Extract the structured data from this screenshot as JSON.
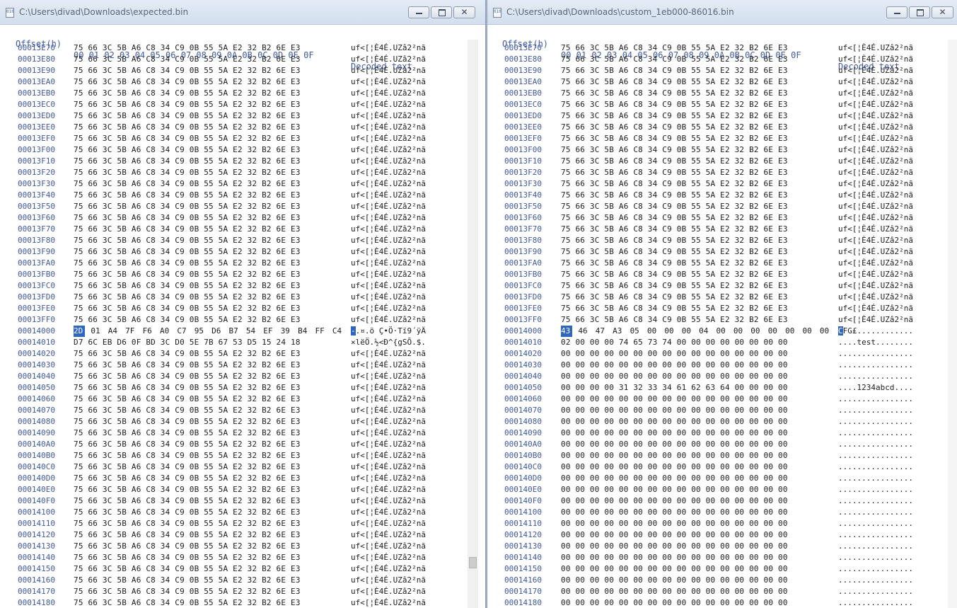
{
  "left": {
    "title": "C:\\Users\\divad\\Downloads\\expected.bin",
    "header": {
      "offset": "Offset(h)",
      "bytes": "00 01 02 03 04 05 06 07 08 09 0A 0B 0C 0D 0E 0F",
      "decoded": "Decoded text"
    },
    "rows": [
      {
        "offset": "00013E70",
        "hex": "75 66 3C 5B A6 C8 34 C9 0B 55 5A E2 32 B2 6E E3",
        "dec": "uf<[¦È4É.UZâ2²nã"
      },
      {
        "offset": "00013E80",
        "hex": "75 66 3C 5B A6 C8 34 C9 0B 55 5A E2 32 B2 6E E3",
        "dec": "uf<[¦È4É.UZâ2²nã"
      },
      {
        "offset": "00013E90",
        "hex": "75 66 3C 5B A6 C8 34 C9 0B 55 5A E2 32 B2 6E E3",
        "dec": "uf<[¦È4É.UZâ2²nã"
      },
      {
        "offset": "00013EA0",
        "hex": "75 66 3C 5B A6 C8 34 C9 0B 55 5A E2 32 B2 6E E3",
        "dec": "uf<[¦È4É.UZâ2²nã"
      },
      {
        "offset": "00013EB0",
        "hex": "75 66 3C 5B A6 C8 34 C9 0B 55 5A E2 32 B2 6E E3",
        "dec": "uf<[¦È4É.UZâ2²nã"
      },
      {
        "offset": "00013EC0",
        "hex": "75 66 3C 5B A6 C8 34 C9 0B 55 5A E2 32 B2 6E E3",
        "dec": "uf<[¦È4É.UZâ2²nã"
      },
      {
        "offset": "00013ED0",
        "hex": "75 66 3C 5B A6 C8 34 C9 0B 55 5A E2 32 B2 6E E3",
        "dec": "uf<[¦È4É.UZâ2²nã"
      },
      {
        "offset": "00013EE0",
        "hex": "75 66 3C 5B A6 C8 34 C9 0B 55 5A E2 32 B2 6E E3",
        "dec": "uf<[¦È4É.UZâ2²nã"
      },
      {
        "offset": "00013EF0",
        "hex": "75 66 3C 5B A6 C8 34 C9 0B 55 5A E2 32 B2 6E E3",
        "dec": "uf<[¦È4É.UZâ2²nã"
      },
      {
        "offset": "00013F00",
        "hex": "75 66 3C 5B A6 C8 34 C9 0B 55 5A E2 32 B2 6E E3",
        "dec": "uf<[¦È4É.UZâ2²nã"
      },
      {
        "offset": "00013F10",
        "hex": "75 66 3C 5B A6 C8 34 C9 0B 55 5A E2 32 B2 6E E3",
        "dec": "uf<[¦È4É.UZâ2²nã"
      },
      {
        "offset": "00013F20",
        "hex": "75 66 3C 5B A6 C8 34 C9 0B 55 5A E2 32 B2 6E E3",
        "dec": "uf<[¦È4É.UZâ2²nã"
      },
      {
        "offset": "00013F30",
        "hex": "75 66 3C 5B A6 C8 34 C9 0B 55 5A E2 32 B2 6E E3",
        "dec": "uf<[¦È4É.UZâ2²nã"
      },
      {
        "offset": "00013F40",
        "hex": "75 66 3C 5B A6 C8 34 C9 0B 55 5A E2 32 B2 6E E3",
        "dec": "uf<[¦È4É.UZâ2²nã"
      },
      {
        "offset": "00013F50",
        "hex": "75 66 3C 5B A6 C8 34 C9 0B 55 5A E2 32 B2 6E E3",
        "dec": "uf<[¦È4É.UZâ2²nã"
      },
      {
        "offset": "00013F60",
        "hex": "75 66 3C 5B A6 C8 34 C9 0B 55 5A E2 32 B2 6E E3",
        "dec": "uf<[¦È4É.UZâ2²nã"
      },
      {
        "offset": "00013F70",
        "hex": "75 66 3C 5B A6 C8 34 C9 0B 55 5A E2 32 B2 6E E3",
        "dec": "uf<[¦È4É.UZâ2²nã"
      },
      {
        "offset": "00013F80",
        "hex": "75 66 3C 5B A6 C8 34 C9 0B 55 5A E2 32 B2 6E E3",
        "dec": "uf<[¦È4É.UZâ2²nã"
      },
      {
        "offset": "00013F90",
        "hex": "75 66 3C 5B A6 C8 34 C9 0B 55 5A E2 32 B2 6E E3",
        "dec": "uf<[¦È4É.UZâ2²nã"
      },
      {
        "offset": "00013FA0",
        "hex": "75 66 3C 5B A6 C8 34 C9 0B 55 5A E2 32 B2 6E E3",
        "dec": "uf<[¦È4É.UZâ2²nã"
      },
      {
        "offset": "00013FB0",
        "hex": "75 66 3C 5B A6 C8 34 C9 0B 55 5A E2 32 B2 6E E3",
        "dec": "uf<[¦È4É.UZâ2²nã"
      },
      {
        "offset": "00013FC0",
        "hex": "75 66 3C 5B A6 C8 34 C9 0B 55 5A E2 32 B2 6E E3",
        "dec": "uf<[¦È4É.UZâ2²nã"
      },
      {
        "offset": "00013FD0",
        "hex": "75 66 3C 5B A6 C8 34 C9 0B 55 5A E2 32 B2 6E E3",
        "dec": "uf<[¦È4É.UZâ2²nã"
      },
      {
        "offset": "00013FE0",
        "hex": "75 66 3C 5B A6 C8 34 C9 0B 55 5A E2 32 B2 6E E3",
        "dec": "uf<[¦È4É.UZâ2²nã"
      },
      {
        "offset": "00013FF0",
        "hex": "75 66 3C 5B A6 C8 34 C9 0B 55 5A E2 32 B2 6E E3",
        "dec": "uf<[¦È4É.UZâ2²nã"
      },
      {
        "offset": "00014000",
        "hex": "2D 01 A4 7F F6 A0 C7 95 D6 B7 54 EF 39 B4 FF C4",
        "dec": "-.¤.ö Ç•Ö·Tï9´ÿÄ",
        "selected": true
      },
      {
        "offset": "00014010",
        "hex": "D7 6C EB D6 0F BD 3C D0 5E 7B 67 53 D5 15 24 18",
        "dec": "×lëÖ.½<Ð^{gSÕ.$."
      },
      {
        "offset": "00014020",
        "hex": "75 66 3C 5B A6 C8 34 C9 0B 55 5A E2 32 B2 6E E3",
        "dec": "uf<[¦È4É.UZâ2²nã"
      },
      {
        "offset": "00014030",
        "hex": "75 66 3C 5B A6 C8 34 C9 0B 55 5A E2 32 B2 6E E3",
        "dec": "uf<[¦È4É.UZâ2²nã"
      },
      {
        "offset": "00014040",
        "hex": "75 66 3C 5B A6 C8 34 C9 0B 55 5A E2 32 B2 6E E3",
        "dec": "uf<[¦È4É.UZâ2²nã"
      },
      {
        "offset": "00014050",
        "hex": "75 66 3C 5B A6 C8 34 C9 0B 55 5A E2 32 B2 6E E3",
        "dec": "uf<[¦È4É.UZâ2²nã"
      },
      {
        "offset": "00014060",
        "hex": "75 66 3C 5B A6 C8 34 C9 0B 55 5A E2 32 B2 6E E3",
        "dec": "uf<[¦È4É.UZâ2²nã"
      },
      {
        "offset": "00014070",
        "hex": "75 66 3C 5B A6 C8 34 C9 0B 55 5A E2 32 B2 6E E3",
        "dec": "uf<[¦È4É.UZâ2²nã"
      },
      {
        "offset": "00014080",
        "hex": "75 66 3C 5B A6 C8 34 C9 0B 55 5A E2 32 B2 6E E3",
        "dec": "uf<[¦È4É.UZâ2²nã"
      },
      {
        "offset": "00014090",
        "hex": "75 66 3C 5B A6 C8 34 C9 0B 55 5A E2 32 B2 6E E3",
        "dec": "uf<[¦È4É.UZâ2²nã"
      },
      {
        "offset": "000140A0",
        "hex": "75 66 3C 5B A6 C8 34 C9 0B 55 5A E2 32 B2 6E E3",
        "dec": "uf<[¦È4É.UZâ2²nã"
      },
      {
        "offset": "000140B0",
        "hex": "75 66 3C 5B A6 C8 34 C9 0B 55 5A E2 32 B2 6E E3",
        "dec": "uf<[¦È4É.UZâ2²nã"
      },
      {
        "offset": "000140C0",
        "hex": "75 66 3C 5B A6 C8 34 C9 0B 55 5A E2 32 B2 6E E3",
        "dec": "uf<[¦È4É.UZâ2²nã"
      },
      {
        "offset": "000140D0",
        "hex": "75 66 3C 5B A6 C8 34 C9 0B 55 5A E2 32 B2 6E E3",
        "dec": "uf<[¦È4É.UZâ2²nã"
      },
      {
        "offset": "000140E0",
        "hex": "75 66 3C 5B A6 C8 34 C9 0B 55 5A E2 32 B2 6E E3",
        "dec": "uf<[¦È4É.UZâ2²nã"
      },
      {
        "offset": "000140F0",
        "hex": "75 66 3C 5B A6 C8 34 C9 0B 55 5A E2 32 B2 6E E3",
        "dec": "uf<[¦È4É.UZâ2²nã"
      },
      {
        "offset": "00014100",
        "hex": "75 66 3C 5B A6 C8 34 C9 0B 55 5A E2 32 B2 6E E3",
        "dec": "uf<[¦È4É.UZâ2²nã"
      },
      {
        "offset": "00014110",
        "hex": "75 66 3C 5B A6 C8 34 C9 0B 55 5A E2 32 B2 6E E3",
        "dec": "uf<[¦È4É.UZâ2²nã"
      },
      {
        "offset": "00014120",
        "hex": "75 66 3C 5B A6 C8 34 C9 0B 55 5A E2 32 B2 6E E3",
        "dec": "uf<[¦È4É.UZâ2²nã"
      },
      {
        "offset": "00014130",
        "hex": "75 66 3C 5B A6 C8 34 C9 0B 55 5A E2 32 B2 6E E3",
        "dec": "uf<[¦È4É.UZâ2²nã"
      },
      {
        "offset": "00014140",
        "hex": "75 66 3C 5B A6 C8 34 C9 0B 55 5A E2 32 B2 6E E3",
        "dec": "uf<[¦È4É.UZâ2²nã"
      },
      {
        "offset": "00014150",
        "hex": "75 66 3C 5B A6 C8 34 C9 0B 55 5A E2 32 B2 6E E3",
        "dec": "uf<[¦È4É.UZâ2²nã"
      },
      {
        "offset": "00014160",
        "hex": "75 66 3C 5B A6 C8 34 C9 0B 55 5A E2 32 B2 6E E3",
        "dec": "uf<[¦È4É.UZâ2²nã"
      },
      {
        "offset": "00014170",
        "hex": "75 66 3C 5B A6 C8 34 C9 0B 55 5A E2 32 B2 6E E3",
        "dec": "uf<[¦È4É.UZâ2²nã"
      },
      {
        "offset": "00014180",
        "hex": "75 66 3C 5B A6 C8 34 C9 0B 55 5A E2 32 B2 6E E3",
        "dec": "uf<[¦È4É.UZâ2²nã"
      }
    ]
  },
  "right": {
    "title": "C:\\Users\\divad\\Downloads\\custom_1eb000-86016.bin",
    "header": {
      "offset": "Offset(h)",
      "bytes": "00 01 02 03 04 05 06 07 08 09 0A 0B 0C 0D 0E 0F",
      "decoded": "Decoded text"
    },
    "rows": [
      {
        "offset": "00013E70",
        "hex": "75 66 3C 5B A6 C8 34 C9 0B 55 5A E2 32 B2 6E E3",
        "dec": "uf<[¦È4É.UZâ2²nã"
      },
      {
        "offset": "00013E80",
        "hex": "75 66 3C 5B A6 C8 34 C9 0B 55 5A E2 32 B2 6E E3",
        "dec": "uf<[¦È4É.UZâ2²nã"
      },
      {
        "offset": "00013E90",
        "hex": "75 66 3C 5B A6 C8 34 C9 0B 55 5A E2 32 B2 6E E3",
        "dec": "uf<[¦È4É.UZâ2²nã"
      },
      {
        "offset": "00013EA0",
        "hex": "75 66 3C 5B A6 C8 34 C9 0B 55 5A E2 32 B2 6E E3",
        "dec": "uf<[¦È4É.UZâ2²nã"
      },
      {
        "offset": "00013EB0",
        "hex": "75 66 3C 5B A6 C8 34 C9 0B 55 5A E2 32 B2 6E E3",
        "dec": "uf<[¦È4É.UZâ2²nã"
      },
      {
        "offset": "00013EC0",
        "hex": "75 66 3C 5B A6 C8 34 C9 0B 55 5A E2 32 B2 6E E3",
        "dec": "uf<[¦È4É.UZâ2²nã"
      },
      {
        "offset": "00013ED0",
        "hex": "75 66 3C 5B A6 C8 34 C9 0B 55 5A E2 32 B2 6E E3",
        "dec": "uf<[¦È4É.UZâ2²nã"
      },
      {
        "offset": "00013EE0",
        "hex": "75 66 3C 5B A6 C8 34 C9 0B 55 5A E2 32 B2 6E E3",
        "dec": "uf<[¦È4É.UZâ2²nã"
      },
      {
        "offset": "00013EF0",
        "hex": "75 66 3C 5B A6 C8 34 C9 0B 55 5A E2 32 B2 6E E3",
        "dec": "uf<[¦È4É.UZâ2²nã"
      },
      {
        "offset": "00013F00",
        "hex": "75 66 3C 5B A6 C8 34 C9 0B 55 5A E2 32 B2 6E E3",
        "dec": "uf<[¦È4É.UZâ2²nã"
      },
      {
        "offset": "00013F10",
        "hex": "75 66 3C 5B A6 C8 34 C9 0B 55 5A E2 32 B2 6E E3",
        "dec": "uf<[¦È4É.UZâ2²nã"
      },
      {
        "offset": "00013F20",
        "hex": "75 66 3C 5B A6 C8 34 C9 0B 55 5A E2 32 B2 6E E3",
        "dec": "uf<[¦È4É.UZâ2²nã"
      },
      {
        "offset": "00013F30",
        "hex": "75 66 3C 5B A6 C8 34 C9 0B 55 5A E2 32 B2 6E E3",
        "dec": "uf<[¦È4É.UZâ2²nã"
      },
      {
        "offset": "00013F40",
        "hex": "75 66 3C 5B A6 C8 34 C9 0B 55 5A E2 32 B2 6E E3",
        "dec": "uf<[¦È4É.UZâ2²nã"
      },
      {
        "offset": "00013F50",
        "hex": "75 66 3C 5B A6 C8 34 C9 0B 55 5A E2 32 B2 6E E3",
        "dec": "uf<[¦È4É.UZâ2²nã"
      },
      {
        "offset": "00013F60",
        "hex": "75 66 3C 5B A6 C8 34 C9 0B 55 5A E2 32 B2 6E E3",
        "dec": "uf<[¦È4É.UZâ2²nã"
      },
      {
        "offset": "00013F70",
        "hex": "75 66 3C 5B A6 C8 34 C9 0B 55 5A E2 32 B2 6E E3",
        "dec": "uf<[¦È4É.UZâ2²nã"
      },
      {
        "offset": "00013F80",
        "hex": "75 66 3C 5B A6 C8 34 C9 0B 55 5A E2 32 B2 6E E3",
        "dec": "uf<[¦È4É.UZâ2²nã"
      },
      {
        "offset": "00013F90",
        "hex": "75 66 3C 5B A6 C8 34 C9 0B 55 5A E2 32 B2 6E E3",
        "dec": "uf<[¦È4É.UZâ2²nã"
      },
      {
        "offset": "00013FA0",
        "hex": "75 66 3C 5B A6 C8 34 C9 0B 55 5A E2 32 B2 6E E3",
        "dec": "uf<[¦È4É.UZâ2²nã"
      },
      {
        "offset": "00013FB0",
        "hex": "75 66 3C 5B A6 C8 34 C9 0B 55 5A E2 32 B2 6E E3",
        "dec": "uf<[¦È4É.UZâ2²nã"
      },
      {
        "offset": "00013FC0",
        "hex": "75 66 3C 5B A6 C8 34 C9 0B 55 5A E2 32 B2 6E E3",
        "dec": "uf<[¦È4É.UZâ2²nã"
      },
      {
        "offset": "00013FD0",
        "hex": "75 66 3C 5B A6 C8 34 C9 0B 55 5A E2 32 B2 6E E3",
        "dec": "uf<[¦È4É.UZâ2²nã"
      },
      {
        "offset": "00013FE0",
        "hex": "75 66 3C 5B A6 C8 34 C9 0B 55 5A E2 32 B2 6E E3",
        "dec": "uf<[¦È4É.UZâ2²nã"
      },
      {
        "offset": "00013FF0",
        "hex": "75 66 3C 5B A6 C8 34 C9 0B 55 5A E2 32 B2 6E E3",
        "dec": "uf<[¦È4É.UZâ2²nã"
      },
      {
        "offset": "00014000",
        "hex": "43 46 47 A3 05 00 00 00 04 00 00 00 00 00 00 00",
        "dec": "CFG£............",
        "selected": true
      },
      {
        "offset": "00014010",
        "hex": "02 00 00 00 74 65 73 74 00 00 00 00 00 00 00 00",
        "dec": "....test........"
      },
      {
        "offset": "00014020",
        "hex": "00 00 00 00 00 00 00 00 00 00 00 00 00 00 00 00",
        "dec": "................"
      },
      {
        "offset": "00014030",
        "hex": "00 00 00 00 00 00 00 00 00 00 00 00 00 00 00 00",
        "dec": "................"
      },
      {
        "offset": "00014040",
        "hex": "00 00 00 00 00 00 00 00 00 00 00 00 00 00 00 00",
        "dec": "................"
      },
      {
        "offset": "00014050",
        "hex": "00 00 00 00 31 32 33 34 61 62 63 64 00 00 00 00",
        "dec": "....1234abcd...."
      },
      {
        "offset": "00014060",
        "hex": "00 00 00 00 00 00 00 00 00 00 00 00 00 00 00 00",
        "dec": "................"
      },
      {
        "offset": "00014070",
        "hex": "00 00 00 00 00 00 00 00 00 00 00 00 00 00 00 00",
        "dec": "................"
      },
      {
        "offset": "00014080",
        "hex": "00 00 00 00 00 00 00 00 00 00 00 00 00 00 00 00",
        "dec": "................"
      },
      {
        "offset": "00014090",
        "hex": "00 00 00 00 00 00 00 00 00 00 00 00 00 00 00 00",
        "dec": "................"
      },
      {
        "offset": "000140A0",
        "hex": "00 00 00 00 00 00 00 00 00 00 00 00 00 00 00 00",
        "dec": "................"
      },
      {
        "offset": "000140B0",
        "hex": "00 00 00 00 00 00 00 00 00 00 00 00 00 00 00 00",
        "dec": "................"
      },
      {
        "offset": "000140C0",
        "hex": "00 00 00 00 00 00 00 00 00 00 00 00 00 00 00 00",
        "dec": "................"
      },
      {
        "offset": "000140D0",
        "hex": "00 00 00 00 00 00 00 00 00 00 00 00 00 00 00 00",
        "dec": "................"
      },
      {
        "offset": "000140E0",
        "hex": "00 00 00 00 00 00 00 00 00 00 00 00 00 00 00 00",
        "dec": "................"
      },
      {
        "offset": "000140F0",
        "hex": "00 00 00 00 00 00 00 00 00 00 00 00 00 00 00 00",
        "dec": "................"
      },
      {
        "offset": "00014100",
        "hex": "00 00 00 00 00 00 00 00 00 00 00 00 00 00 00 00",
        "dec": "................"
      },
      {
        "offset": "00014110",
        "hex": "00 00 00 00 00 00 00 00 00 00 00 00 00 00 00 00",
        "dec": "................"
      },
      {
        "offset": "00014120",
        "hex": "00 00 00 00 00 00 00 00 00 00 00 00 00 00 00 00",
        "dec": "................"
      },
      {
        "offset": "00014130",
        "hex": "00 00 00 00 00 00 00 00 00 00 00 00 00 00 00 00",
        "dec": "................"
      },
      {
        "offset": "00014140",
        "hex": "00 00 00 00 00 00 00 00 00 00 00 00 00 00 00 00",
        "dec": "................"
      },
      {
        "offset": "00014150",
        "hex": "00 00 00 00 00 00 00 00 00 00 00 00 00 00 00 00",
        "dec": "................"
      },
      {
        "offset": "00014160",
        "hex": "00 00 00 00 00 00 00 00 00 00 00 00 00 00 00 00",
        "dec": "................"
      },
      {
        "offset": "00014170",
        "hex": "00 00 00 00 00 00 00 00 00 00 00 00 00 00 00 00",
        "dec": "................"
      },
      {
        "offset": "00014180",
        "hex": "00 00 00 00 00 00 00 00 00 00 00 00 00 00 00 00",
        "dec": "................"
      }
    ]
  },
  "caption_buttons": {
    "minimize": "minimize-icon",
    "maximize": "maximize-icon",
    "close": "close-icon",
    "close_glyph": "✕"
  },
  "colors": {
    "offset_text": "#3f5aa8",
    "selection": "#2f66c4",
    "titlebar": "#dbe5f1"
  }
}
